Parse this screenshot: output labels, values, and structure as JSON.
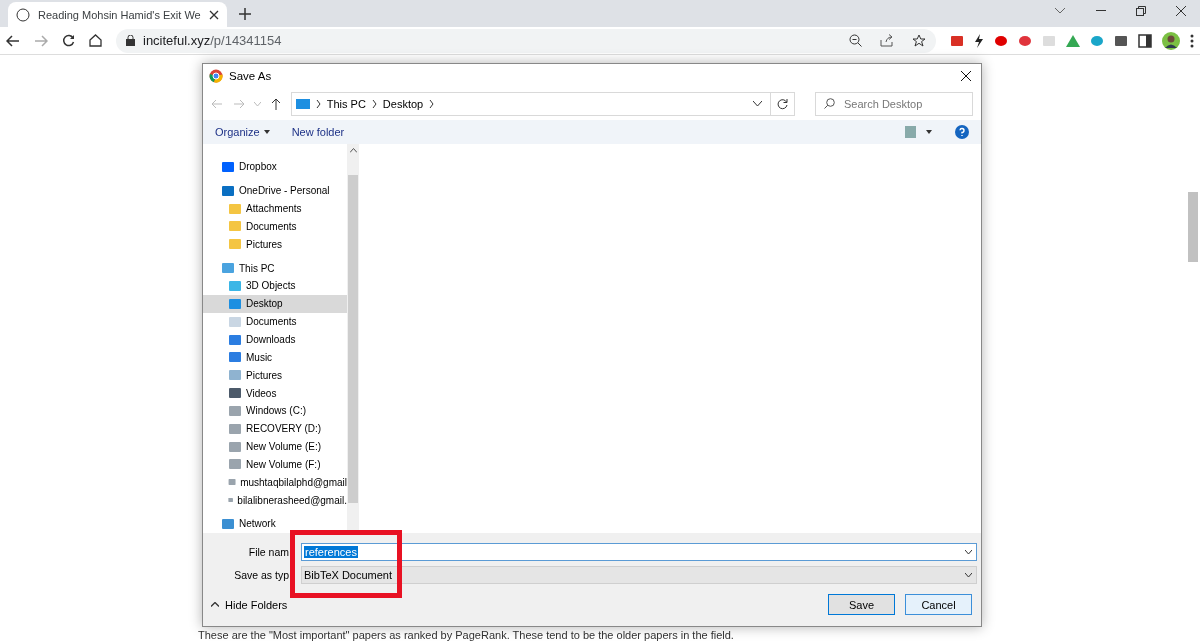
{
  "browser": {
    "tab": {
      "title": "Reading Mohsin Hamid's Exit We",
      "selected": true
    },
    "url_host": "inciteful.xyz",
    "url_path": "/p/14341154"
  },
  "page": {
    "paragraph": "These are the \"Most important\" papers as ranked by PageRank. These tend to be the older papers in the field."
  },
  "dialog": {
    "title": "Save As",
    "breadcrumb": [
      "This PC",
      "Desktop"
    ],
    "search": {
      "placeholder": "Search Desktop"
    },
    "toolbar": [
      "Organize",
      "New folder"
    ],
    "nav": [
      {
        "label": "Dropbox",
        "selected": false
      },
      {
        "label": "OneDrive - Personal",
        "selected": false,
        "children": [
          {
            "label": "Attachments",
            "selected": false
          },
          {
            "label": "Documents",
            "selected": false
          },
          {
            "label": "Pictures",
            "selected": false
          }
        ]
      },
      {
        "label": "This PC",
        "selected": false,
        "children": [
          {
            "label": "3D Objects",
            "selected": false
          },
          {
            "label": "Desktop",
            "selected": true
          },
          {
            "label": "Documents",
            "selected": false
          },
          {
            "label": "Downloads",
            "selected": false
          },
          {
            "label": "Music",
            "selected": false
          },
          {
            "label": "Pictures",
            "selected": false
          },
          {
            "label": "Videos",
            "selected": false
          },
          {
            "label": "Windows (C:)",
            "selected": false
          },
          {
            "label": "RECOVERY (D:)",
            "selected": false
          },
          {
            "label": "New Volume (E:)",
            "selected": false
          },
          {
            "label": "New Volume (F:)",
            "selected": false
          },
          {
            "label": "mushtaqbilalphd@gmail",
            "selected": false
          },
          {
            "label": "bilalibnerasheed@gmail.",
            "selected": false
          }
        ]
      },
      {
        "label": "Network",
        "selected": false
      }
    ],
    "file_name": {
      "label": "File nam",
      "value": "references"
    },
    "save_type": {
      "label": "Save as typ",
      "value": "BibTeX Document"
    },
    "hide_folders": "Hide Folders",
    "save": "Save",
    "cancel": "Cancel"
  }
}
